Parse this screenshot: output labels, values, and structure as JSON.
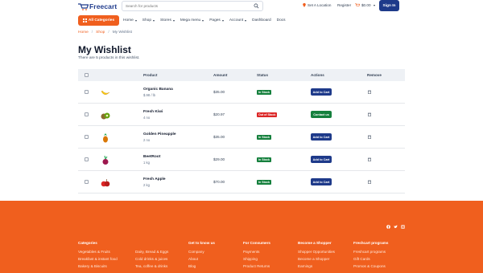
{
  "header": {
    "logo_text": "Freecart",
    "search_placeholder": "Search for products",
    "location": "Set A Location",
    "register": "Register",
    "cart": "$0.00",
    "signin": "Sign In"
  },
  "nav": {
    "all_categories": "All Categories",
    "items": [
      "Home",
      "Shop",
      "Stores",
      "Mega menu",
      "Pages",
      "Account",
      "Dashboard",
      "Docs"
    ]
  },
  "breadcrumb": {
    "home": "Home",
    "shop": "Shop",
    "current": "My Wishlist",
    "sep": "/"
  },
  "page": {
    "title": "My Wishlist",
    "subtitle": "There are 5 products in this wishlist."
  },
  "table": {
    "headers": {
      "product": "Product",
      "amount": "Amount",
      "status": "Status",
      "actions": "Actions",
      "remove": "Remove"
    },
    "rows": [
      {
        "name": "Organic Banana",
        "weight": "$.98 / lb",
        "amount": "$35.00",
        "status": "In Stock",
        "status_type": "in",
        "action": "Add to Cart",
        "action_type": "cart",
        "fruit": "banana"
      },
      {
        "name": "Fresh Kiwi",
        "weight": "4 no",
        "amount": "$20.97",
        "status": "Out of Stock",
        "status_type": "out",
        "action": "Contact us",
        "action_type": "contact",
        "fruit": "kiwi"
      },
      {
        "name": "Golden Pineapple",
        "weight": "2 no",
        "amount": "$35.00",
        "status": "In Stock",
        "status_type": "in",
        "action": "Add to Cart",
        "action_type": "cart",
        "fruit": "pineapple"
      },
      {
        "name": "BeetRoot",
        "weight": "1 kg",
        "amount": "$29.00",
        "status": "In Stock",
        "status_type": "in",
        "action": "Add to Cart",
        "action_type": "cart",
        "fruit": "beetroot"
      },
      {
        "name": "Fresh Apple",
        "weight": "2 kg",
        "amount": "$70.00",
        "status": "In Stock",
        "status_type": "in",
        "action": "Add to Cart",
        "action_type": "cart",
        "fruit": "apple"
      }
    ]
  },
  "footer": {
    "columns": [
      {
        "heading": "Categories",
        "links": [
          "Vegetables & Fruits",
          "Breakfast & instant food",
          "Bakery & Biscuits"
        ]
      },
      {
        "heading": "",
        "links": [
          "Dairy, Bread & Eggs",
          "Cold drinks & juices",
          "Tea, coffee & drinks"
        ]
      },
      {
        "heading": "Get to know us",
        "links": [
          "Company",
          "About",
          "Blog"
        ]
      },
      {
        "heading": "For Consumers",
        "links": [
          "Payments",
          "Shipping",
          "Product Returns"
        ]
      },
      {
        "heading": "Become a Shopper",
        "links": [
          "Shopper Opportunities",
          "Become a Shopper",
          "Earnings"
        ]
      },
      {
        "heading": "Freshcart programs",
        "links": [
          "Freshcart programs",
          "Gift Cards",
          "Promos & Coupons"
        ]
      }
    ]
  },
  "colors": {
    "brand": "#f05f1e",
    "primary": "#1e3a8a",
    "success": "#15803d",
    "danger": "#dc2626"
  }
}
